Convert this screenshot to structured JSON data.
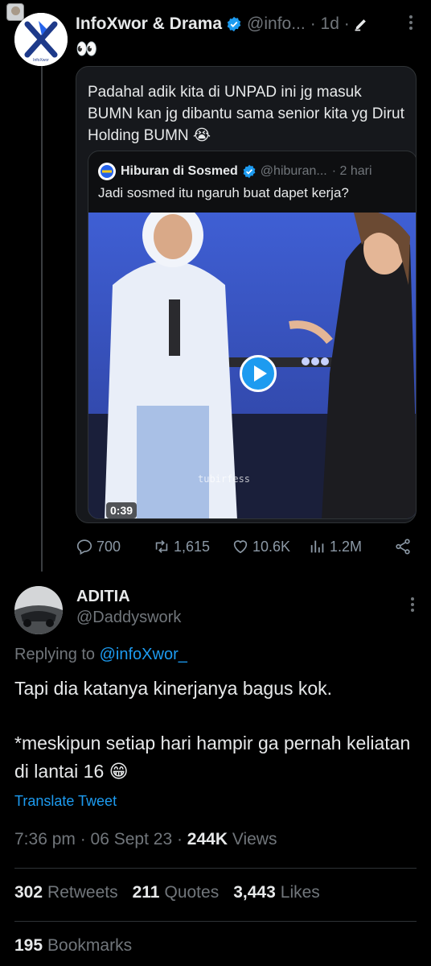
{
  "tweet1": {
    "author_name": "InfoXwor & Drama",
    "handle": "@info...",
    "time": "· 1d ·",
    "text": "👀",
    "stats": {
      "replies": "700",
      "retweets": "1,615",
      "likes": "10.6K",
      "views": "1.2M"
    }
  },
  "quote1": {
    "text": "Padahal adik kita di UNPAD ini jg masuk BUMN kan jg dibantu sama senior kita yg Dirut Holding BUMN 😭"
  },
  "quote2": {
    "author_name": "Hiburan di Sosmed",
    "handle": "@hiburan...",
    "time": "· 2 hari",
    "text": "Jadi sosmed itu ngaruh buat dapet kerja?",
    "video_duration": "0:39",
    "watermark": "tubirfess"
  },
  "tweet2": {
    "author_name": "ADITIA",
    "handle": "@Daddyswork",
    "replying_prefix": "Replying to ",
    "replying_handle": "@infoXwor_",
    "paragraph1": "Tapi dia katanya kinerjanya bagus kok.",
    "paragraph2": "*meskipun setiap hari hampir ga pernah keliatan di lantai 16 😁",
    "translate_label": "Translate Tweet",
    "time": "7:36 pm · 06 Sept 23 · ",
    "views_count": "244K",
    "views_label": " Views",
    "retweets_count": "302",
    "retweets_label": "Retweets",
    "quotes_count": "211",
    "quotes_label": "Quotes",
    "likes_count": "3,443",
    "likes_label": "Likes",
    "bookmarks_count": "195",
    "bookmarks_label": "Bookmarks"
  },
  "colors": {
    "accent": "#1d9bf0",
    "muted": "#71767b",
    "text": "#e7e9ea",
    "background": "#000000"
  }
}
